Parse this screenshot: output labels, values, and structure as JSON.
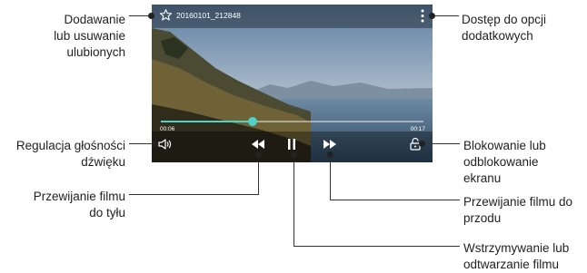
{
  "player": {
    "file_name": "20160101_212848",
    "elapsed": "00:06",
    "duration": "00:17",
    "progress": 0.35
  },
  "colors": {
    "accent": "#4fd1c5"
  },
  "icons": [
    "star-icon",
    "more-options-icon",
    "volume-icon",
    "rewind-icon",
    "pause-icon",
    "fast-forward-icon",
    "lock-icon"
  ],
  "callouts": {
    "favorites": [
      "Dodawanie",
      "lub usuwanie",
      "ulubionych"
    ],
    "more_options": [
      "Dostęp do opcji",
      "dodatkowych"
    ],
    "volume": [
      "Regulacja głośności",
      "dźwięku"
    ],
    "lock": [
      "Blokowanie lub",
      "odblokowanie",
      "ekranu"
    ],
    "rewind": [
      "Przewijanie filmu",
      "do tyłu"
    ],
    "forward": [
      "Przewijanie filmu do",
      "przodu"
    ],
    "pause": [
      "Wstrzymywanie lub",
      "odtwarzanie filmu"
    ]
  }
}
